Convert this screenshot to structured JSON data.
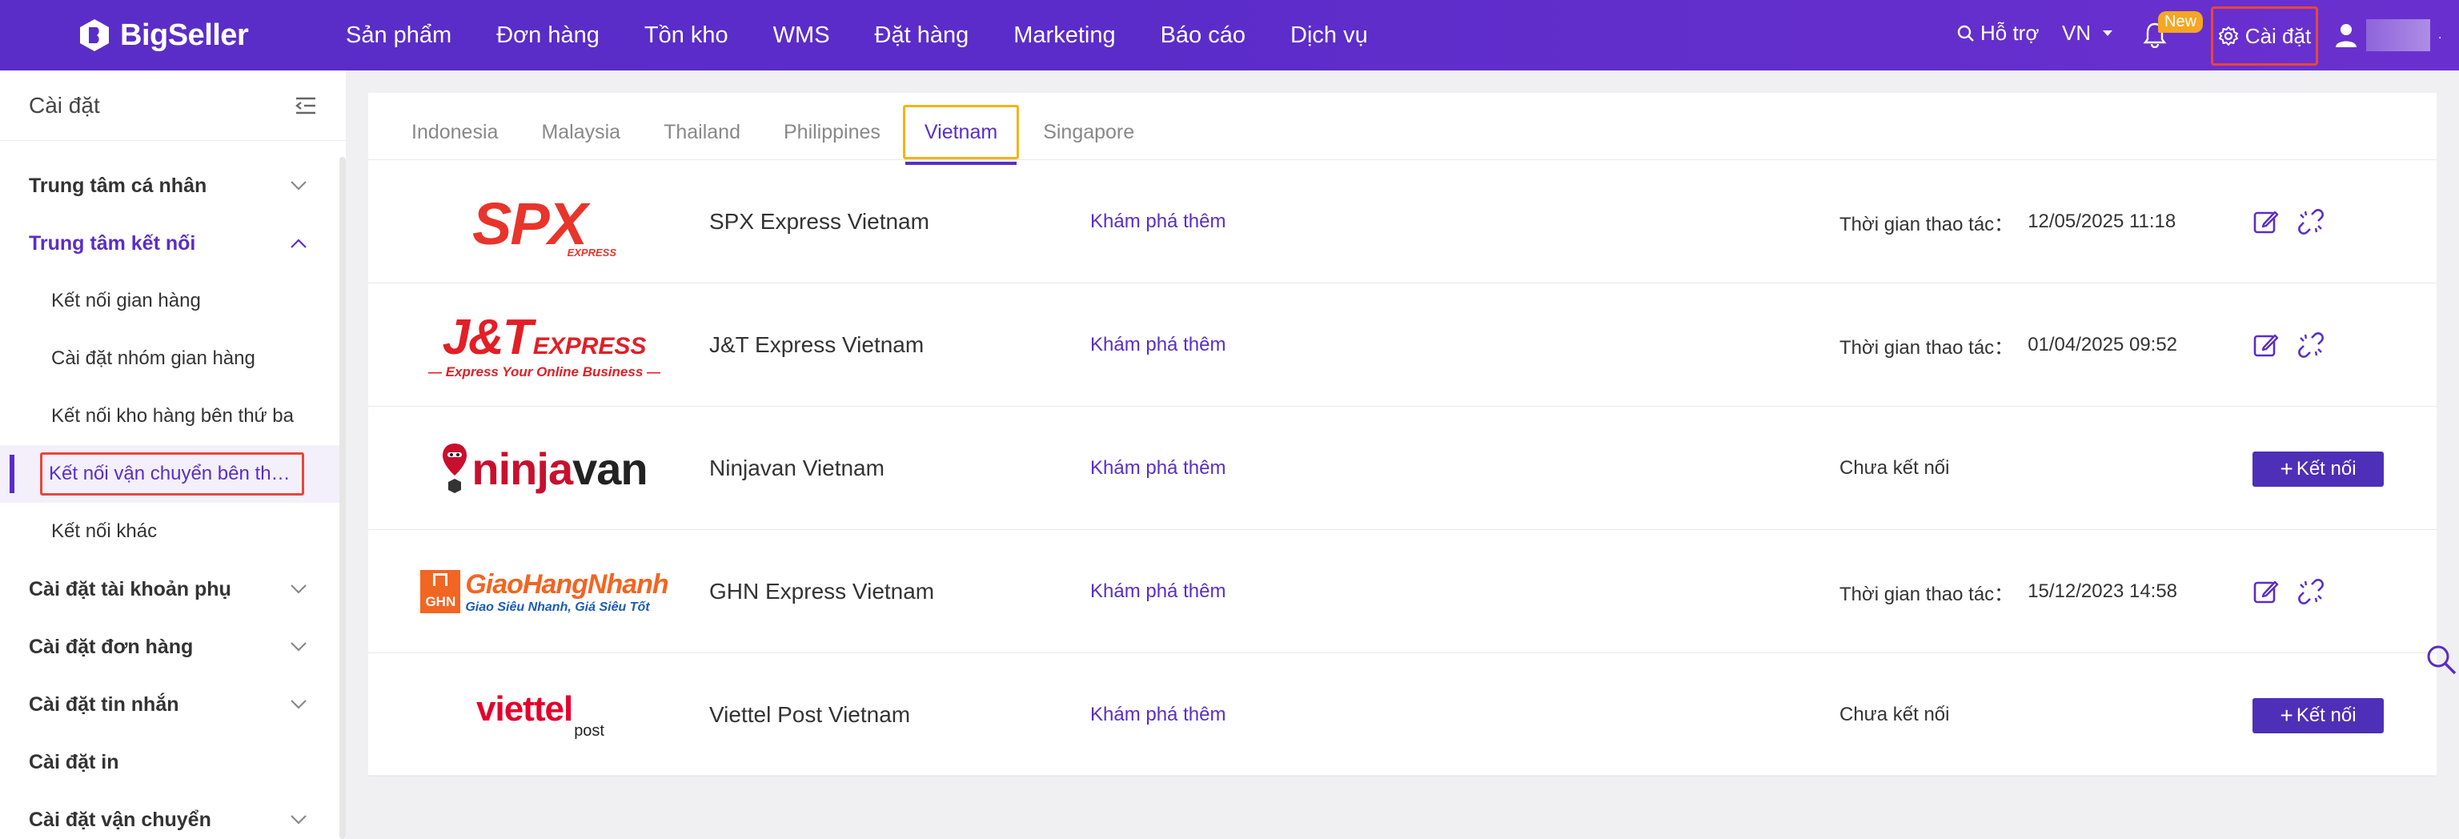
{
  "header": {
    "logo_text": "BigSeller",
    "nav": [
      "Sản phẩm",
      "Đơn hàng",
      "Tồn kho",
      "WMS",
      "Đặt hàng",
      "Marketing",
      "Báo cáo",
      "Dịch vụ"
    ],
    "support_label": "Hỗ trợ",
    "lang": "VN",
    "new_badge": "New",
    "settings_label": "Cài đặt",
    "user_suffix": "."
  },
  "sidebar": {
    "title": "Cài đặt",
    "sections": [
      {
        "label": "Trung tâm cá nhân"
      },
      {
        "label": "Trung tâm kết nối"
      },
      {
        "label": "Cài đặt tài khoản phụ"
      },
      {
        "label": "Cài đặt đơn hàng"
      },
      {
        "label": "Cài đặt tin nhắn"
      },
      {
        "label": "Cài đặt in"
      },
      {
        "label": "Cài đặt vận chuyển"
      }
    ],
    "connect_children": [
      "Kết nối gian hàng",
      "Cài đặt nhóm gian hàng",
      "Kết nối kho hàng bên thứ ba",
      "Kết nối vận chuyển bên thứ ba",
      "Kết nối khác"
    ]
  },
  "tabs": [
    "Indonesia",
    "Malaysia",
    "Thailand",
    "Philippines",
    "Vietnam",
    "Singapore"
  ],
  "carriers": [
    {
      "name": "SPX Express Vietnam",
      "explore": "Khám phá thêm",
      "status_label": "Thời gian thao tác：",
      "time": "12/05/2025 11:18",
      "logo": {
        "main": "SPX",
        "sub": "EXPRESS"
      }
    },
    {
      "name": "J&T Express Vietnam",
      "explore": "Khám phá thêm",
      "status_label": "Thời gian thao tác：",
      "time": "01/04/2025 09:52",
      "logo": {
        "main": "J&T",
        "sub": "EXPRESS",
        "tagline": "— Express Your Online Business —"
      }
    },
    {
      "name": "Ninjavan Vietnam",
      "explore": "Khám phá thêm",
      "status_label": "Chưa kết nối",
      "time": "",
      "connect": "Kết nối",
      "logo": {
        "main_a": "ninja",
        "main_b": "van"
      }
    },
    {
      "name": "GHN Express Vietnam",
      "explore": "Khám phá thêm",
      "status_label": "Thời gian thao tác：",
      "time": "15/12/2023 14:58",
      "logo": {
        "box": "GHN",
        "main": "GiaoHangNhanh",
        "sub": "Giao Siêu Nhanh, Giá Siêu Tốt"
      }
    },
    {
      "name": "Viettel Post Vietnam",
      "explore": "Khám phá thêm",
      "status_label": "Chưa kết nối",
      "time": "",
      "connect": "Kết nối",
      "logo": {
        "main": "viettel",
        "sub": "post"
      }
    }
  ],
  "colors": {
    "primary": "#5a2dc8",
    "highlight_red": "#e8463a",
    "highlight_yellow": "#f2b418",
    "button": "#4e2fb8"
  }
}
